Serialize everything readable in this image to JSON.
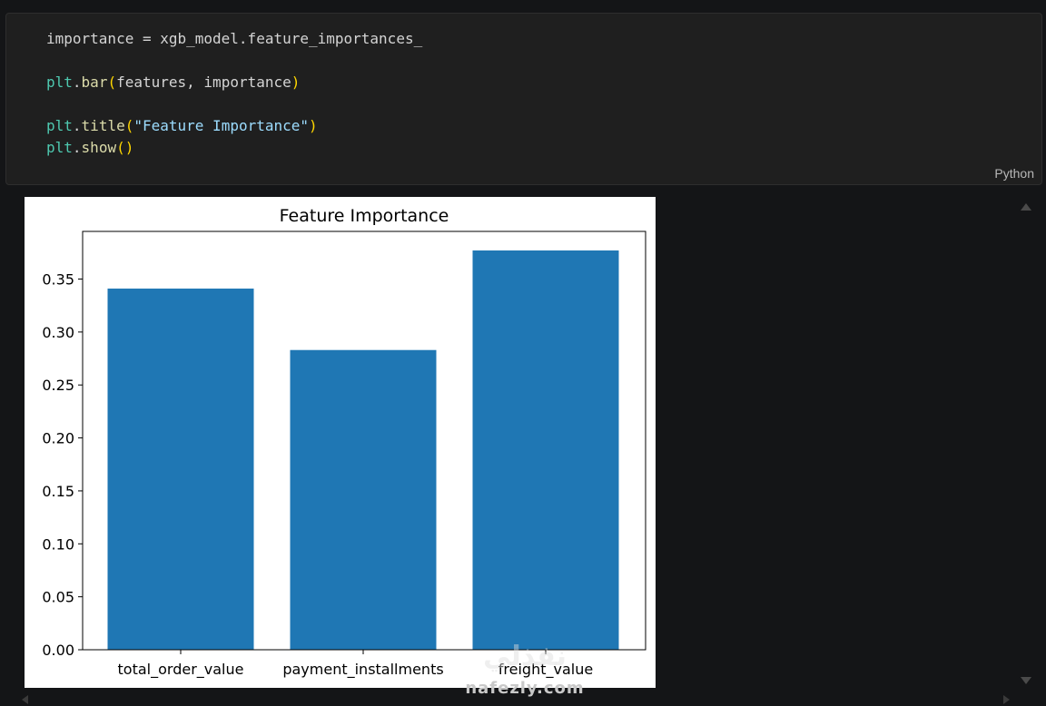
{
  "code_cell": {
    "lines": [
      [
        {
          "t": "importance = xgb_model.feature_importances_",
          "c": "default"
        }
      ],
      [],
      [
        {
          "t": "plt",
          "c": "mod"
        },
        {
          "t": ".",
          "c": "default"
        },
        {
          "t": "bar",
          "c": "func"
        },
        {
          "t": "(",
          "c": "paren"
        },
        {
          "t": "features, importance",
          "c": "default"
        },
        {
          "t": ")",
          "c": "paren"
        }
      ],
      [],
      [
        {
          "t": "plt",
          "c": "mod"
        },
        {
          "t": ".",
          "c": "default"
        },
        {
          "t": "title",
          "c": "func"
        },
        {
          "t": "(",
          "c": "paren"
        },
        {
          "t": "\"Feature Importance\"",
          "c": "var"
        },
        {
          "t": ")",
          "c": "paren"
        }
      ],
      [
        {
          "t": "plt",
          "c": "mod"
        },
        {
          "t": ".",
          "c": "default"
        },
        {
          "t": "show",
          "c": "func"
        },
        {
          "t": "()",
          "c": "paren"
        }
      ]
    ],
    "language_label": "Python"
  },
  "watermark": {
    "arabic": "نفذلي",
    "latin": "nafezly.com"
  },
  "chart_data": {
    "type": "bar",
    "title": "Feature Importance",
    "categories": [
      "total_order_value",
      "payment_installments",
      "freight_value"
    ],
    "values": [
      0.341,
      0.283,
      0.377
    ],
    "yticks": [
      "0.00",
      "0.05",
      "0.10",
      "0.15",
      "0.20",
      "0.25",
      "0.30",
      "0.35"
    ],
    "ylim": [
      0,
      0.395
    ],
    "bar_color": "#1f77b4",
    "grid": false
  }
}
